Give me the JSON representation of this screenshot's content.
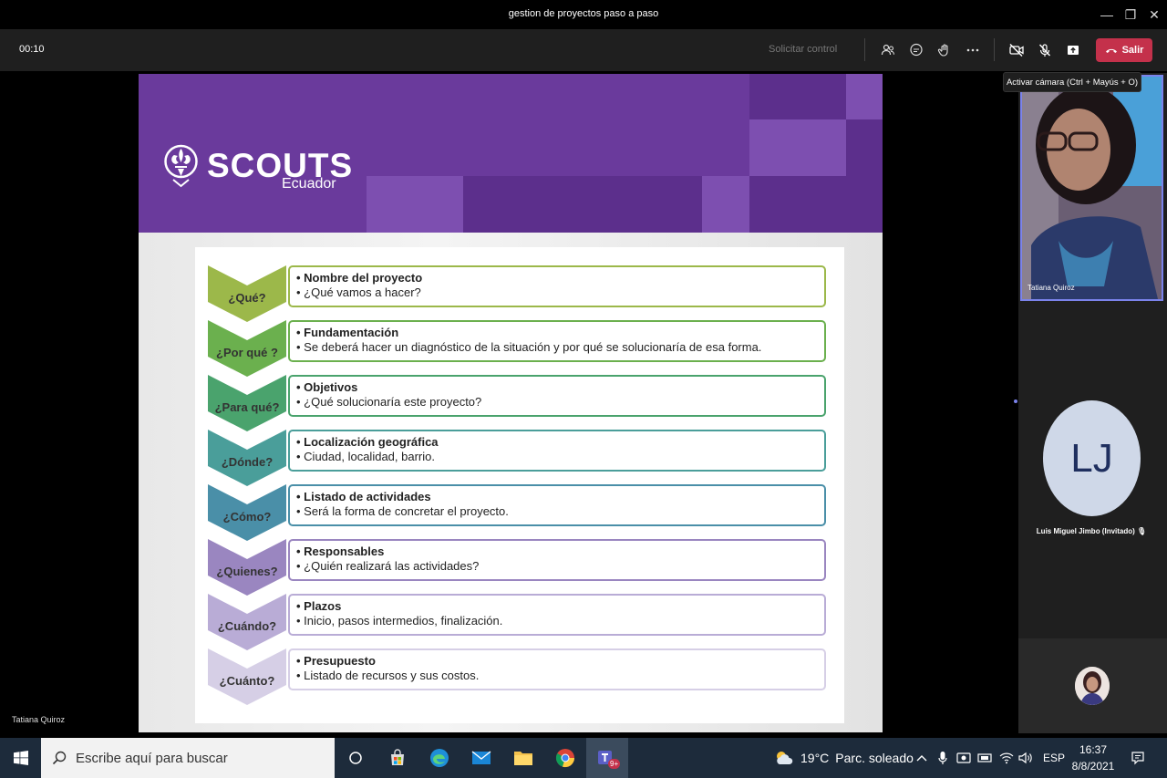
{
  "window": {
    "title": "gestion de proyectos paso a paso",
    "minimize": "—",
    "restore": "❐",
    "close": "✕"
  },
  "toolbar": {
    "timer": "00:10",
    "request_control": "Solicitar control",
    "leave_label": "Salir",
    "leave_color": "#c4314b"
  },
  "tooltip": "Activar cámara (Ctrl + Mayús + O)",
  "stage": {
    "presenter_name": "Tatiana Quiroz"
  },
  "slide": {
    "brand": "SCOUTS",
    "country": "Ecuador",
    "header_color": "#6a3a9c",
    "rows": [
      {
        "question": "¿Qué?",
        "heading": "• Nombre del proyecto",
        "detail": "• ¿Qué vamos a hacer?",
        "color": "#9cb84a"
      },
      {
        "question": "¿Por qué ?",
        "heading": "• Fundamentación",
        "detail": "• Se deberá hacer un diagnóstico de la situación y por qué se solucionaría de esa forma.",
        "color": "#6bb04e"
      },
      {
        "question": "¿Para qué?",
        "heading": "• Objetivos",
        "detail": "• ¿Qué solucionaría este proyecto?",
        "color": "#4aa36d"
      },
      {
        "question": "¿Dónde?",
        "heading": "• Localización geográfica",
        "detail": "• Ciudad, localidad, barrio.",
        "color": "#4a9e9a"
      },
      {
        "question": "¿Cómo?",
        "heading": "• Listado de actividades",
        "detail": "• Será la forma de concretar el proyecto.",
        "color": "#4a8fa8"
      },
      {
        "question": "¿Quienes?",
        "heading": "• Responsables",
        "detail": "• ¿Quién realizará las actividades?",
        "color": "#9a86c0"
      },
      {
        "question": "¿Cuándo?",
        "heading": "• Plazos",
        "detail": "• Inicio, pasos intermedios, finalización.",
        "color": "#b9acd6"
      },
      {
        "question": "¿Cuánto?",
        "heading": "• Presupuesto",
        "detail": "• Listado de recursos y sus costos.",
        "color": "#d6cfe6"
      }
    ]
  },
  "participants": {
    "camera_name": "Tatiana Quiroz",
    "lj_initials": "LJ",
    "lj_name": "Luis Miguel Jimbo (Invitado)"
  },
  "taskbar": {
    "search_placeholder": "Escribe aquí para buscar",
    "weather_temp": "19°C",
    "weather_desc": "Parc. soleado",
    "language": "ESP",
    "time": "16:37",
    "date": "8/8/2021",
    "teams_badge": "9+"
  }
}
